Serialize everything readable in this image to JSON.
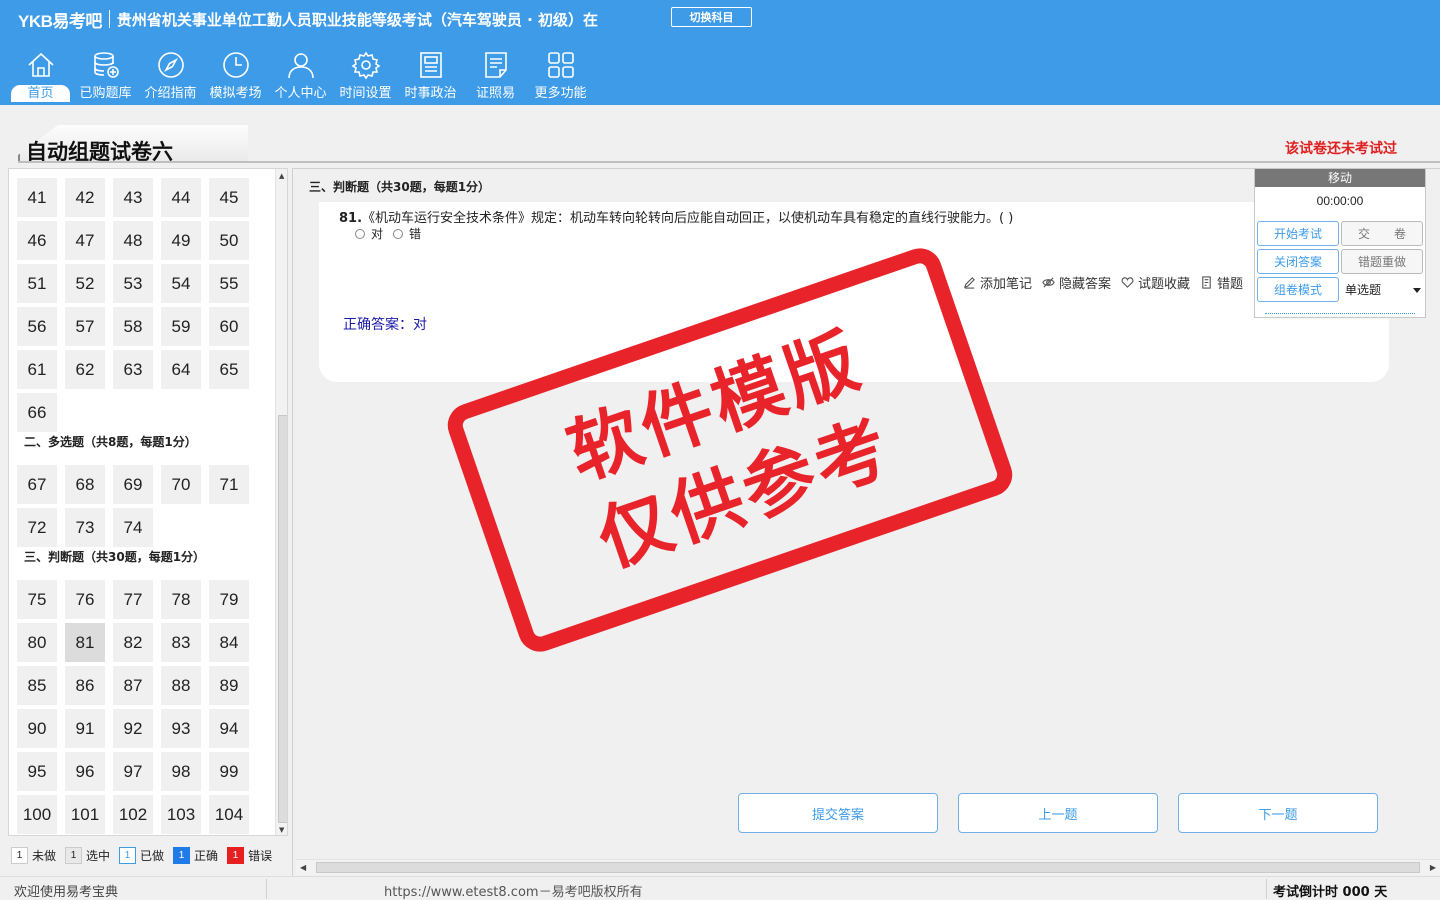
{
  "header": {
    "brand": "YKB易考吧",
    "exam_name": "贵州省机关事业单位工勤人员职业技能等级考试（汽车驾驶员 · 初级）在",
    "switch_subject": "切换科目",
    "nav": [
      {
        "label": "首页",
        "icon": "home-icon"
      },
      {
        "label": "已购题库",
        "icon": "database-icon"
      },
      {
        "label": "介绍指南",
        "icon": "compass-icon"
      },
      {
        "label": "模拟考场",
        "icon": "clock-icon"
      },
      {
        "label": "个人中心",
        "icon": "user-icon"
      },
      {
        "label": "时间设置",
        "icon": "gear-icon"
      },
      {
        "label": "时事政治",
        "icon": "newspaper-icon"
      },
      {
        "label": "证照易",
        "icon": "certificate-icon"
      },
      {
        "label": "更多功能",
        "icon": "grid-icon"
      }
    ]
  },
  "page": {
    "title": "自动组题试卷六",
    "status": "该试卷还未考试过"
  },
  "question_nav": {
    "rows_top": [
      [
        "41",
        "42",
        "43",
        "44",
        "45"
      ],
      [
        "46",
        "47",
        "48",
        "49",
        "50"
      ],
      [
        "51",
        "52",
        "53",
        "54",
        "55"
      ],
      [
        "56",
        "57",
        "58",
        "59",
        "60"
      ],
      [
        "61",
        "62",
        "63",
        "64",
        "65"
      ],
      [
        "66"
      ]
    ],
    "section2_title": "二、多选题（共8题，每题1分）",
    "rows_sec2": [
      [
        "67",
        "68",
        "69",
        "70",
        "71"
      ],
      [
        "72",
        "73",
        "74"
      ]
    ],
    "section3_title": "三、判断题（共30题，每题1分）",
    "rows_sec3": [
      [
        "75",
        "76",
        "77",
        "78",
        "79"
      ],
      [
        "80",
        "81",
        "82",
        "83",
        "84"
      ],
      [
        "85",
        "86",
        "87",
        "88",
        "89"
      ],
      [
        "90",
        "91",
        "92",
        "93",
        "94"
      ],
      [
        "95",
        "96",
        "97",
        "98",
        "99"
      ],
      [
        "100",
        "101",
        "102",
        "103",
        "104"
      ]
    ],
    "current": "81"
  },
  "legend": [
    {
      "count": "1",
      "label": "未做",
      "kind": "undone"
    },
    {
      "count": "1",
      "label": "选中",
      "kind": "selected"
    },
    {
      "count": "1",
      "label": "已做",
      "kind": "done"
    },
    {
      "count": "1",
      "label": "正确",
      "kind": "correct"
    },
    {
      "count": "1",
      "label": "错误",
      "kind": "wrong"
    }
  ],
  "question": {
    "section_header": "三、判断题（共30题，每题1分）",
    "number": "81.",
    "text": "《机动车运行安全技术条件》规定：机动车转向轮转向后应能自动回正，以使机动车具有稳定的直线行驶能力。(  )",
    "options": [
      "对",
      "错"
    ],
    "answer": "正确答案：对"
  },
  "actions": {
    "add_note": "添加笔记",
    "hide_answer": "隐藏答案",
    "favorite": "试题收藏",
    "error_report": "错题"
  },
  "widget": {
    "move": "移动",
    "timer": "00:00:00",
    "start_exam": "开始考试",
    "submit_paper": "交　　卷",
    "close_answer": "关闭答案",
    "redo_wrong": "错题重做",
    "compose_mode": "组卷模式",
    "mode_value": "单选题"
  },
  "watermark": {
    "line1": "软件模版",
    "line2": "仅供参考"
  },
  "buttons": {
    "submit_answer": "提交答案",
    "prev": "上一题",
    "next": "下一题"
  },
  "status_bar": {
    "welcome": "欢迎使用易考宝典",
    "copyright": "https://www.etest8.com－易考吧版权所有",
    "countdown": "考试倒计时 000 天"
  },
  "colors": {
    "header_blue": "#3d9be8",
    "status_red": "#e02020",
    "watermark_red": "#e8232a",
    "answer_blue": "#1a1aa8"
  }
}
